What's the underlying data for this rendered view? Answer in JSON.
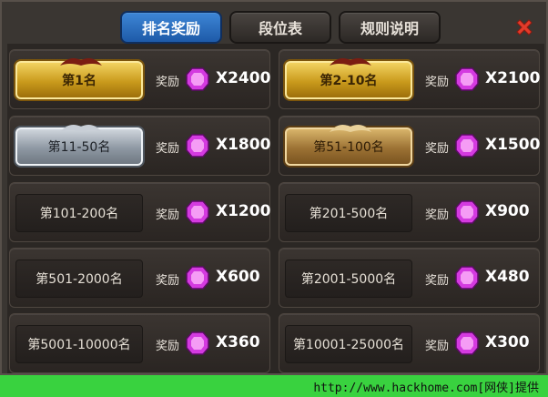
{
  "tabs": [
    {
      "label": "排名奖励",
      "active": true
    },
    {
      "label": "段位表",
      "active": false
    },
    {
      "label": "规则说明",
      "active": false
    }
  ],
  "reward_label": "奖励",
  "rows": [
    {
      "rank": "第1名",
      "qty": "X2400",
      "style": "gold"
    },
    {
      "rank": "第2-10名",
      "qty": "X2100",
      "style": "gold"
    },
    {
      "rank": "第11-50名",
      "qty": "X1800",
      "style": "silver"
    },
    {
      "rank": "第51-100名",
      "qty": "X1500",
      "style": "bronze"
    },
    {
      "rank": "第101-200名",
      "qty": "X1200",
      "style": "plain"
    },
    {
      "rank": "第201-500名",
      "qty": "X900",
      "style": "plain"
    },
    {
      "rank": "第501-2000名",
      "qty": "X600",
      "style": "plain"
    },
    {
      "rank": "第2001-5000名",
      "qty": "X480",
      "style": "plain"
    },
    {
      "rank": "第5001-10000名",
      "qty": "X360",
      "style": "plain"
    },
    {
      "rank": "第10001-25000名",
      "qty": "X300",
      "style": "plain"
    }
  ],
  "icons": {
    "close": "close-icon",
    "gem": "gem-icon"
  },
  "colors": {
    "active_tab": "#2f72c4",
    "gem": "#e040e8",
    "close": "#e23b2a"
  },
  "watermark": "http://www.hackhome.com[网侠]提供"
}
